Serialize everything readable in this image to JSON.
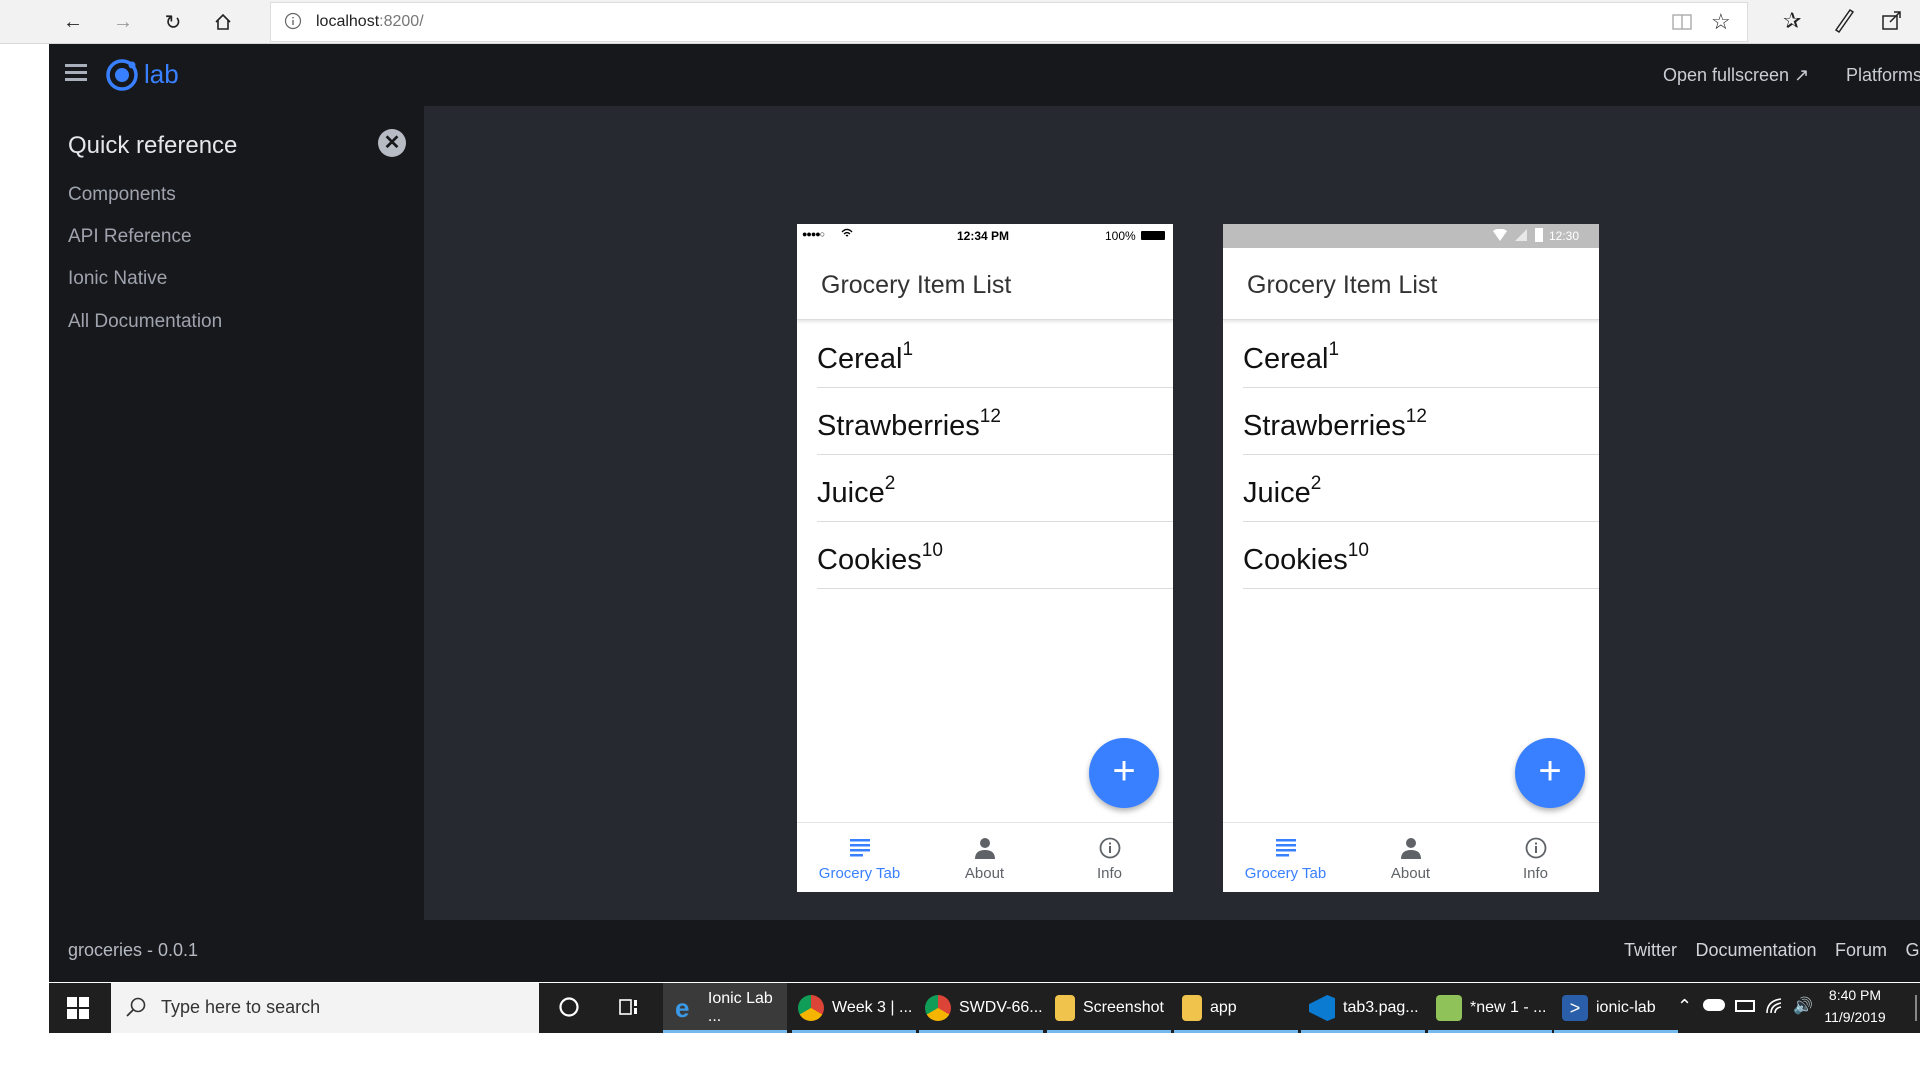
{
  "browser": {
    "url_host": "localhost",
    "url_port": ":8200/"
  },
  "lab": {
    "logo_text": "lab",
    "open_fullscreen": "Open fullscreen",
    "platforms": "Platforms",
    "sidebar_title": "Quick reference",
    "sidebar_items": [
      "Components",
      "API Reference",
      "Ionic Native",
      "All Documentation"
    ],
    "version": "groceries - 0.0.1",
    "footer_links": [
      "Twitter",
      "Documentation",
      "Forum",
      "GitHub"
    ]
  },
  "ios_phone": {
    "carrier_dots": "●●●●○",
    "time": "12:34 PM",
    "battery": "100%"
  },
  "android_phone": {
    "time": "12:30"
  },
  "app": {
    "title": "Grocery Item List",
    "items": [
      {
        "name": "Cereal",
        "qty": "1"
      },
      {
        "name": "Strawberries",
        "qty": "12"
      },
      {
        "name": "Juice",
        "qty": "2"
      },
      {
        "name": "Cookies",
        "qty": "10"
      }
    ],
    "fab_label": "+",
    "tabs": [
      "Grocery Tab",
      "About",
      "Info"
    ]
  },
  "taskbar": {
    "search_placeholder": "Type here to search",
    "apps": [
      "Ionic Lab ...",
      "Week 3 | ...",
      "SWDV-66...",
      "Screenshot",
      "app",
      "tab3.pag...",
      "*new 1 - ...",
      "ionic-lab"
    ],
    "time": "8:40 PM",
    "date": "11/9/2019"
  },
  "colors": {
    "ionic_blue": "#3880ff",
    "lab_bg": "#17181c",
    "stage_bg": "#262a30"
  }
}
